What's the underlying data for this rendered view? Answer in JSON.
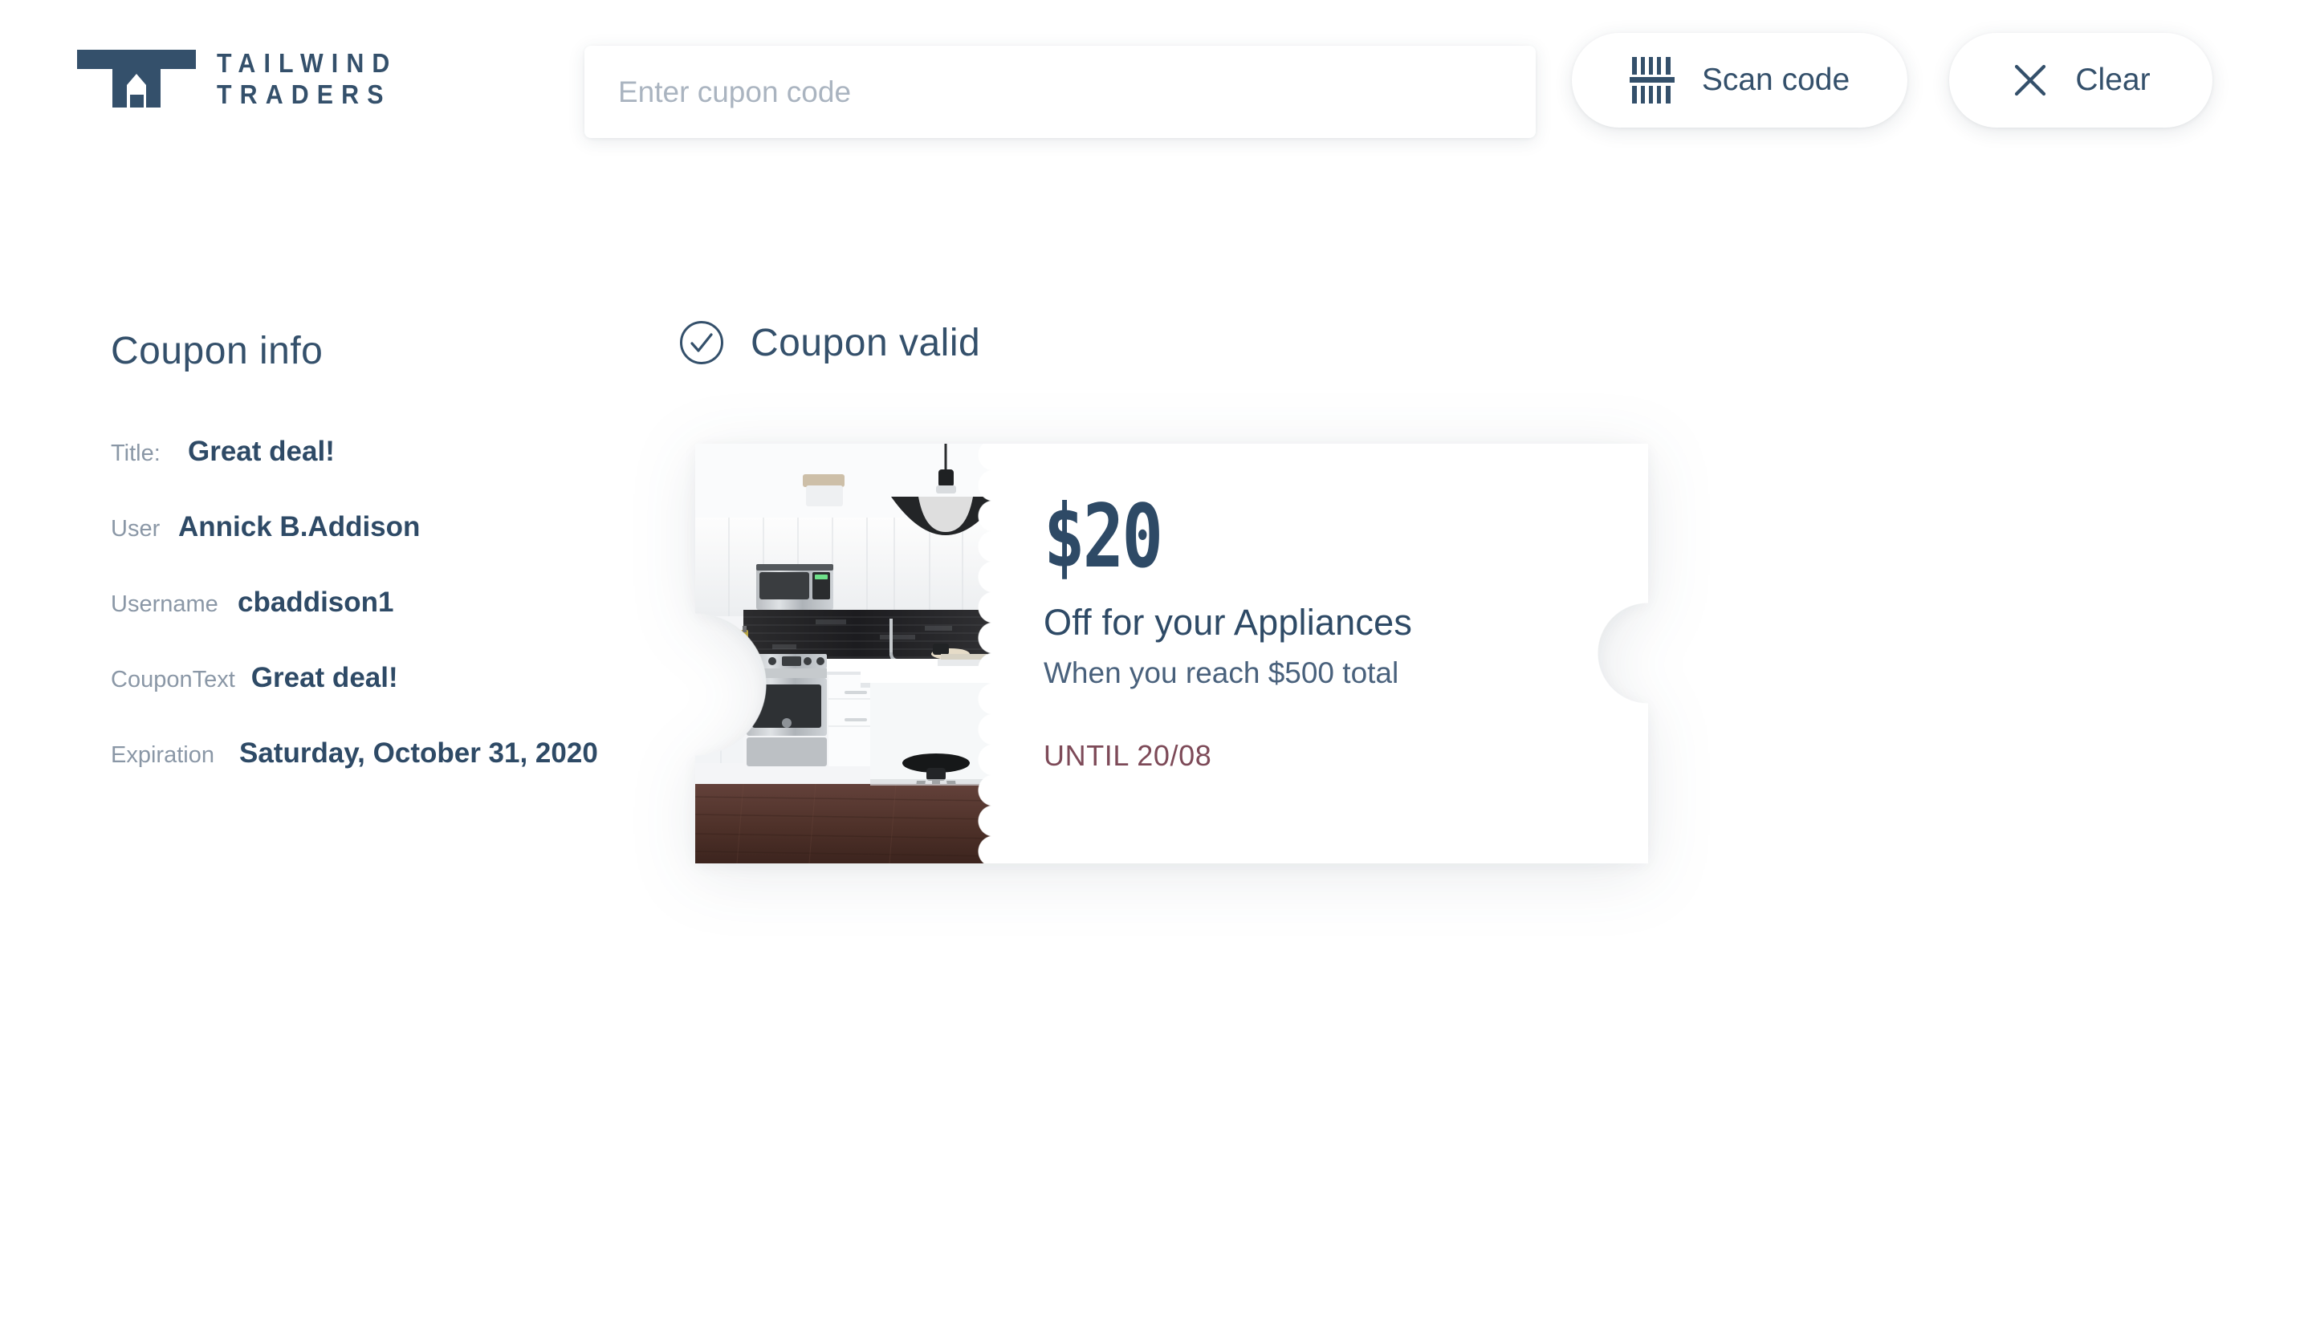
{
  "brand": {
    "name_line1": "TAILWIND",
    "name_line2": "TRADERS",
    "logo_icon": "house-logo-icon",
    "color": "#34506b"
  },
  "header": {
    "search": {
      "placeholder": "Enter cupon code",
      "value": ""
    },
    "scan_button": {
      "label": "Scan code",
      "icon": "barcode-icon"
    },
    "clear_button": {
      "label": "Clear",
      "icon": "close-icon"
    }
  },
  "coupon_info": {
    "heading": "Coupon info",
    "rows": [
      {
        "label": "Title:",
        "value": "Great deal!"
      },
      {
        "label": "User",
        "value": "Annick B.Addison"
      },
      {
        "label": "Username",
        "value": "cbaddison1"
      },
      {
        "label": "CouponText",
        "value": "Great deal!"
      },
      {
        "label": "Expiration",
        "value": "Saturday, October 31, 2020"
      }
    ]
  },
  "status": {
    "text": "Coupon valid",
    "icon": "check-circle-icon",
    "color": "#34506b"
  },
  "coupon_card": {
    "amount": "$20",
    "headline": "Off for your Appliances",
    "subtext": "When you reach $500 total",
    "until": "UNTIL 20/08",
    "until_color": "#7d4a58",
    "image_alt": "modern-kitchen-photo"
  }
}
